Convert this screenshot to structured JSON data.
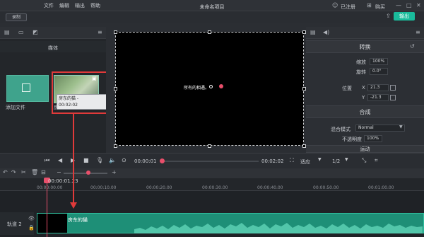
{
  "app": {
    "title": "未命名项目",
    "menu": [
      "文件",
      "编辑",
      "输出",
      "帮助"
    ],
    "record_label": "录制",
    "user_label": "已注册",
    "buy_label": "购买",
    "export_label": "输出"
  },
  "left_panel": {
    "header": "媒体",
    "add_file_label": "添加文件",
    "thumb_label": "房东的猫 -",
    "tooltip_line1": "房东的猫 -",
    "tooltip_line2": "00:02:02"
  },
  "preview": {
    "subtitle": "所有的相遇。"
  },
  "right_panel": {
    "section_transform": "转换",
    "scale_label": "缩放",
    "scale_value": "100%",
    "rotate_label": "旋转",
    "rotate_value": "0.0°",
    "position_label": "位置",
    "x_label": "X",
    "x_value": "21.3",
    "y_label": "Y",
    "y_value": "-21.3",
    "section_composite": "合成",
    "blend_label": "混合模式",
    "blend_value": "Normal",
    "opacity_label": "不透明度",
    "opacity_value": "100%",
    "section_motion": "运动"
  },
  "transport": {
    "time_current": "00:00:01",
    "time_total": "00:02:02",
    "fit_label": "适应",
    "page": "1/2"
  },
  "timeline": {
    "playhead_time": "00:00:01.23",
    "ticks": [
      "00:00:00.00",
      "00:00:10.00",
      "00:00:20.00",
      "00:00:30.00",
      "00:00:40.00",
      "00:00:50.00",
      "00:01:00.00"
    ],
    "track_label": "轨道 2",
    "clip_label": "房东的猫"
  }
}
